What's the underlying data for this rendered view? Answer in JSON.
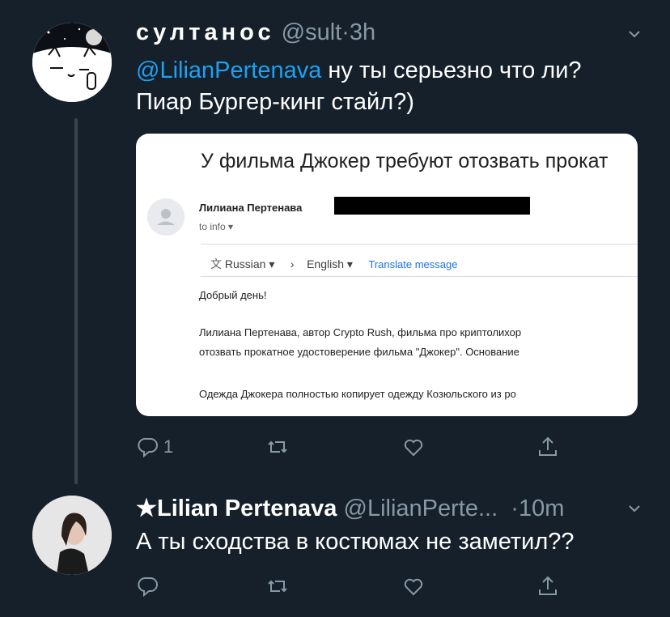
{
  "tweet1": {
    "display_name": "султанос",
    "handle": "@sult",
    "separator": "·",
    "time": "3h",
    "mention": "@LilianPertenava",
    "text_after_mention": " ну ты серьезно что ли?",
    "text_line2": "Пиар Бургер-кинг стайл?)",
    "reply_count": "1",
    "embed": {
      "subject": "У фильма Джокер требуют отозвать прокат",
      "sender": "Лилиана Пертенава",
      "to": "to info",
      "source_lang": "Russian",
      "target_lang": "English",
      "translate_link": "Translate message",
      "greeting": "Добрый день!",
      "para1_line1": "Лилиана Пертенава, автор Crypto Rush, фильма про криптолихор",
      "para1_line2": "отозвать прокатное удостоверение фильма \"Джокер\". Основание",
      "para2_line1": "Одежда Джокера полностью копирует одежду Козюльского из ро"
    }
  },
  "tweet2": {
    "star": "★",
    "display_name": "Lilian Pertenava",
    "handle": "@LilianPerte...",
    "separator": "·",
    "time": "10m",
    "text": "А ты сходства в костюмах не заметил??"
  },
  "colors": {
    "background": "#15202b",
    "text": "#ffffff",
    "muted": "#8899a6",
    "link": "#1da1f2",
    "thread_line": "#38444d"
  },
  "icons": [
    "reply-icon",
    "retweet-icon",
    "like-icon",
    "share-icon",
    "chevron-down-icon",
    "translate-icon"
  ]
}
